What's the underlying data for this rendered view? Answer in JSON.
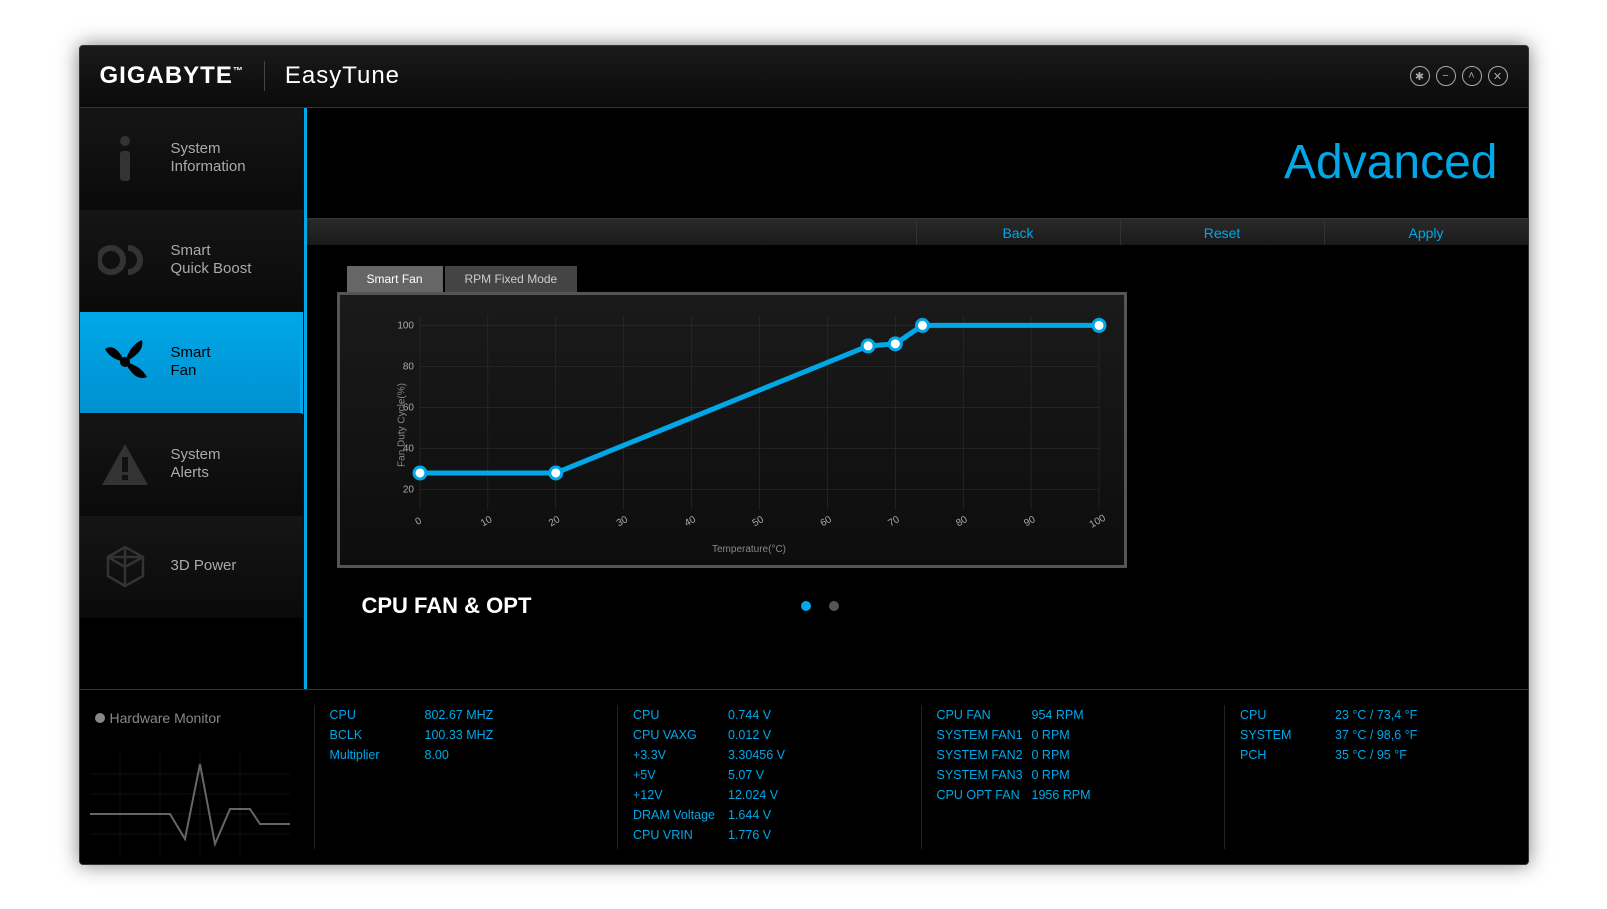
{
  "brand": "GIGABYTE",
  "app_name": "EasyTune",
  "window_controls": [
    "settings",
    "minimize",
    "maximize",
    "close"
  ],
  "sidebar": {
    "items": [
      {
        "id": "system-info",
        "line1": "System",
        "line2": "Information",
        "icon": "info"
      },
      {
        "id": "quick-boost",
        "line1": "Smart",
        "line2": "Quick Boost",
        "icon": "oc"
      },
      {
        "id": "smart-fan",
        "line1": "Smart",
        "line2": "Fan",
        "icon": "fan",
        "active": true
      },
      {
        "id": "system-alerts",
        "line1": "System",
        "line2": "Alerts",
        "icon": "alert"
      },
      {
        "id": "3d-power",
        "line1": "",
        "line2": "3D Power",
        "icon": "cube"
      }
    ]
  },
  "page_title": "Advanced",
  "actions": {
    "back": "Back",
    "reset": "Reset",
    "apply": "Apply"
  },
  "tabs": [
    {
      "label": "Smart Fan",
      "active": true
    },
    {
      "label": "RPM Fixed Mode",
      "active": false
    }
  ],
  "chart_data": {
    "type": "line",
    "title": "CPU FAN & OPT",
    "xlabel": "Temperature(°C)",
    "ylabel": "Fan Duty Cycle(%)",
    "x_ticks": [
      0,
      10,
      20,
      30,
      40,
      50,
      60,
      70,
      80,
      90,
      100
    ],
    "y_ticks": [
      20,
      40,
      60,
      80,
      100
    ],
    "xlim": [
      0,
      100
    ],
    "ylim": [
      10,
      105
    ],
    "x": [
      0,
      20,
      66,
      70,
      74,
      100
    ],
    "y": [
      28,
      28,
      90,
      91,
      100,
      100
    ]
  },
  "pager": {
    "count": 2,
    "active": 0
  },
  "hw_monitor_title": "Hardware Monitor",
  "monitor": {
    "col1": [
      {
        "k": "CPU",
        "v": "802.67 MHZ"
      },
      {
        "k": "BCLK",
        "v": "100.33 MHZ"
      },
      {
        "k": "Multiplier",
        "v": "8.00"
      }
    ],
    "col2": [
      {
        "k": "CPU",
        "v": "0.744 V"
      },
      {
        "k": "CPU VAXG",
        "v": "0.012 V"
      },
      {
        "k": "+3.3V",
        "v": "3.30456 V"
      },
      {
        "k": "+5V",
        "v": "5.07 V"
      },
      {
        "k": "+12V",
        "v": "12.024 V"
      },
      {
        "k": "DRAM Voltage",
        "v": "1.644 V"
      },
      {
        "k": "CPU VRIN",
        "v": "1.776 V"
      }
    ],
    "col3": [
      {
        "k": "CPU FAN",
        "v": "954 RPM"
      },
      {
        "k": "SYSTEM FAN1",
        "v": "0 RPM"
      },
      {
        "k": "SYSTEM FAN2",
        "v": "0 RPM"
      },
      {
        "k": "SYSTEM FAN3",
        "v": "0 RPM"
      },
      {
        "k": "CPU OPT FAN",
        "v": "1956 RPM"
      }
    ],
    "col4": [
      {
        "k": "CPU",
        "v": "23 °C / 73,4 °F"
      },
      {
        "k": "SYSTEM",
        "v": "37 °C / 98,6 °F"
      },
      {
        "k": "PCH",
        "v": "35 °C / 95 °F"
      }
    ]
  }
}
